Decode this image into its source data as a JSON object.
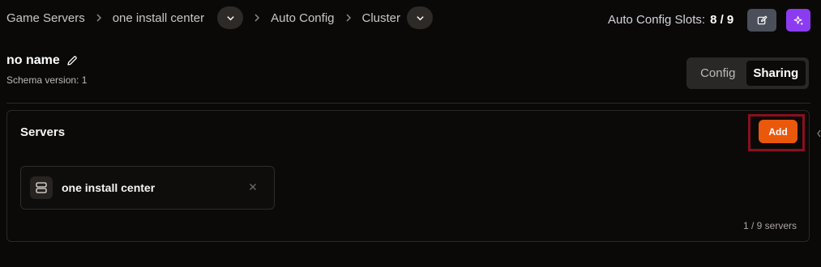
{
  "breadcrumb": {
    "items": [
      {
        "label": "Game Servers"
      },
      {
        "label": "one install center"
      },
      {
        "label": "Auto Config"
      },
      {
        "label": "Cluster"
      }
    ]
  },
  "header": {
    "slots_label": "Auto Config Slots:",
    "slots_value": "8 / 9",
    "edit_icon": "square-pen-icon",
    "ai_icon": "sparkles-icon"
  },
  "config": {
    "title": "no name",
    "schema_version": "Schema version: 1",
    "tabs": [
      {
        "label": "Config",
        "active": false
      },
      {
        "label": "Sharing",
        "active": true
      }
    ]
  },
  "servers": {
    "title": "Servers",
    "add_label": "Add",
    "items": [
      {
        "name": "one install center",
        "icon": "server-icon"
      }
    ],
    "count": "1 / 9 servers"
  },
  "colors": {
    "accent_orange": "#ea580c",
    "accent_purple": "#8b3cf0",
    "highlight_border": "#8a0f1f",
    "background": "#0b0908"
  }
}
